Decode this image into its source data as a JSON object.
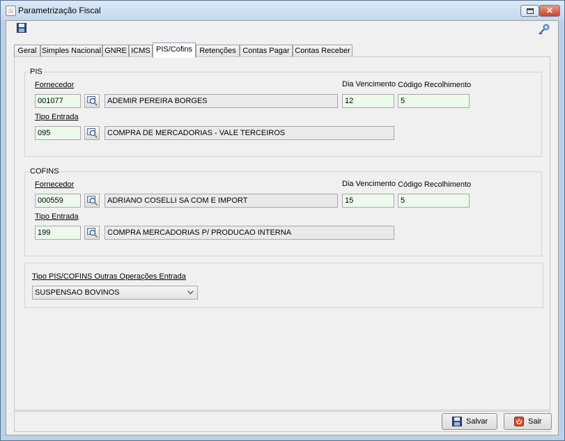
{
  "window": {
    "title": "Parametrização Fiscal"
  },
  "tabs": [
    {
      "label": "Geral"
    },
    {
      "label": "Simples Nacional"
    },
    {
      "label": "GNRE"
    },
    {
      "label": "ICMS"
    },
    {
      "label": "PIS/Cofins"
    },
    {
      "label": "Retenções"
    },
    {
      "label": "Contas Pagar"
    },
    {
      "label": "Contas Receber"
    }
  ],
  "active_tab": "PIS/Cofins",
  "pis": {
    "title": "PIS",
    "fornecedor_label": "Fornecedor",
    "fornecedor_code": "001077",
    "fornecedor_name": "ADEMIR PEREIRA BORGES",
    "dia_vencimento_label": "Dia Vencimento",
    "dia_vencimento": "12",
    "codigo_recolhimento_label": "Código Recolhimento",
    "codigo_recolhimento": "5",
    "tipo_entrada_label": "Tipo Entrada",
    "tipo_entrada_code": "095",
    "tipo_entrada_desc": "COMPRA DE MERCADORIAS - VALE TERCEIROS"
  },
  "cofins": {
    "title": "COFINS",
    "fornecedor_label": "Fornecedor",
    "fornecedor_code": "000559",
    "fornecedor_name": "ADRIANO COSELLI SA COM E IMPORT",
    "dia_vencimento_label": "Dia Vencimento",
    "dia_vencimento": "15",
    "codigo_recolhimento_label": "Código Recolhimento",
    "codigo_recolhimento": "5",
    "tipo_entrada_label": "Tipo Entrada",
    "tipo_entrada_code": "199",
    "tipo_entrada_desc": "COMPRA MERCADORIAS P/ PRODUCAO INTERNA"
  },
  "outras": {
    "label": "Tipo PIS/COFINS Outras Operações Entrada",
    "selected": "SUSPENSAO BOVINOS"
  },
  "buttons": {
    "save": "Salvar",
    "exit": "Sair"
  },
  "colors": {
    "field_green": "#ebfaeb",
    "field_gray": "#eaeaea",
    "close_red": "#c6442c"
  }
}
